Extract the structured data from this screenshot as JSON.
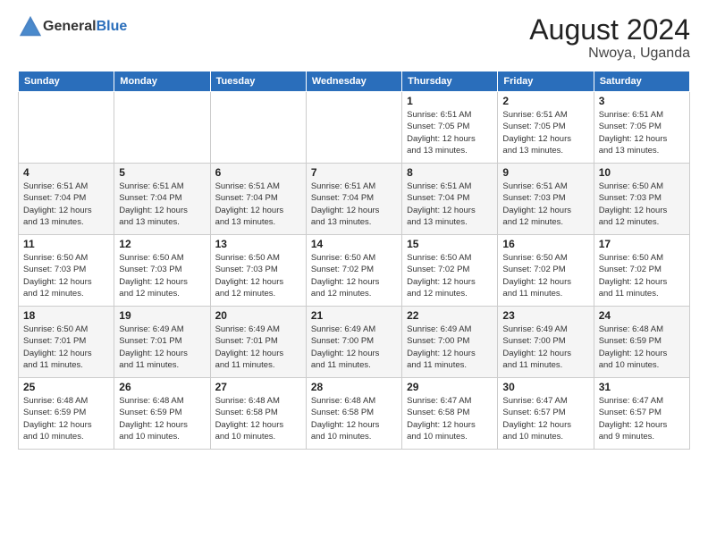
{
  "header": {
    "logo_general": "General",
    "logo_blue": "Blue",
    "main_title": "August 2024",
    "sub_title": "Nwoya, Uganda"
  },
  "days_of_week": [
    "Sunday",
    "Monday",
    "Tuesday",
    "Wednesday",
    "Thursday",
    "Friday",
    "Saturday"
  ],
  "weeks": [
    [
      {
        "num": "",
        "detail": ""
      },
      {
        "num": "",
        "detail": ""
      },
      {
        "num": "",
        "detail": ""
      },
      {
        "num": "",
        "detail": ""
      },
      {
        "num": "1",
        "detail": "Sunrise: 6:51 AM\nSunset: 7:05 PM\nDaylight: 12 hours\nand 13 minutes."
      },
      {
        "num": "2",
        "detail": "Sunrise: 6:51 AM\nSunset: 7:05 PM\nDaylight: 12 hours\nand 13 minutes."
      },
      {
        "num": "3",
        "detail": "Sunrise: 6:51 AM\nSunset: 7:05 PM\nDaylight: 12 hours\nand 13 minutes."
      }
    ],
    [
      {
        "num": "4",
        "detail": "Sunrise: 6:51 AM\nSunset: 7:04 PM\nDaylight: 12 hours\nand 13 minutes."
      },
      {
        "num": "5",
        "detail": "Sunrise: 6:51 AM\nSunset: 7:04 PM\nDaylight: 12 hours\nand 13 minutes."
      },
      {
        "num": "6",
        "detail": "Sunrise: 6:51 AM\nSunset: 7:04 PM\nDaylight: 12 hours\nand 13 minutes."
      },
      {
        "num": "7",
        "detail": "Sunrise: 6:51 AM\nSunset: 7:04 PM\nDaylight: 12 hours\nand 13 minutes."
      },
      {
        "num": "8",
        "detail": "Sunrise: 6:51 AM\nSunset: 7:04 PM\nDaylight: 12 hours\nand 13 minutes."
      },
      {
        "num": "9",
        "detail": "Sunrise: 6:51 AM\nSunset: 7:03 PM\nDaylight: 12 hours\nand 12 minutes."
      },
      {
        "num": "10",
        "detail": "Sunrise: 6:50 AM\nSunset: 7:03 PM\nDaylight: 12 hours\nand 12 minutes."
      }
    ],
    [
      {
        "num": "11",
        "detail": "Sunrise: 6:50 AM\nSunset: 7:03 PM\nDaylight: 12 hours\nand 12 minutes."
      },
      {
        "num": "12",
        "detail": "Sunrise: 6:50 AM\nSunset: 7:03 PM\nDaylight: 12 hours\nand 12 minutes."
      },
      {
        "num": "13",
        "detail": "Sunrise: 6:50 AM\nSunset: 7:03 PM\nDaylight: 12 hours\nand 12 minutes."
      },
      {
        "num": "14",
        "detail": "Sunrise: 6:50 AM\nSunset: 7:02 PM\nDaylight: 12 hours\nand 12 minutes."
      },
      {
        "num": "15",
        "detail": "Sunrise: 6:50 AM\nSunset: 7:02 PM\nDaylight: 12 hours\nand 12 minutes."
      },
      {
        "num": "16",
        "detail": "Sunrise: 6:50 AM\nSunset: 7:02 PM\nDaylight: 12 hours\nand 11 minutes."
      },
      {
        "num": "17",
        "detail": "Sunrise: 6:50 AM\nSunset: 7:02 PM\nDaylight: 12 hours\nand 11 minutes."
      }
    ],
    [
      {
        "num": "18",
        "detail": "Sunrise: 6:50 AM\nSunset: 7:01 PM\nDaylight: 12 hours\nand 11 minutes."
      },
      {
        "num": "19",
        "detail": "Sunrise: 6:49 AM\nSunset: 7:01 PM\nDaylight: 12 hours\nand 11 minutes."
      },
      {
        "num": "20",
        "detail": "Sunrise: 6:49 AM\nSunset: 7:01 PM\nDaylight: 12 hours\nand 11 minutes."
      },
      {
        "num": "21",
        "detail": "Sunrise: 6:49 AM\nSunset: 7:00 PM\nDaylight: 12 hours\nand 11 minutes."
      },
      {
        "num": "22",
        "detail": "Sunrise: 6:49 AM\nSunset: 7:00 PM\nDaylight: 12 hours\nand 11 minutes."
      },
      {
        "num": "23",
        "detail": "Sunrise: 6:49 AM\nSunset: 7:00 PM\nDaylight: 12 hours\nand 11 minutes."
      },
      {
        "num": "24",
        "detail": "Sunrise: 6:48 AM\nSunset: 6:59 PM\nDaylight: 12 hours\nand 10 minutes."
      }
    ],
    [
      {
        "num": "25",
        "detail": "Sunrise: 6:48 AM\nSunset: 6:59 PM\nDaylight: 12 hours\nand 10 minutes."
      },
      {
        "num": "26",
        "detail": "Sunrise: 6:48 AM\nSunset: 6:59 PM\nDaylight: 12 hours\nand 10 minutes."
      },
      {
        "num": "27",
        "detail": "Sunrise: 6:48 AM\nSunset: 6:58 PM\nDaylight: 12 hours\nand 10 minutes."
      },
      {
        "num": "28",
        "detail": "Sunrise: 6:48 AM\nSunset: 6:58 PM\nDaylight: 12 hours\nand 10 minutes."
      },
      {
        "num": "29",
        "detail": "Sunrise: 6:47 AM\nSunset: 6:58 PM\nDaylight: 12 hours\nand 10 minutes."
      },
      {
        "num": "30",
        "detail": "Sunrise: 6:47 AM\nSunset: 6:57 PM\nDaylight: 12 hours\nand 10 minutes."
      },
      {
        "num": "31",
        "detail": "Sunrise: 6:47 AM\nSunset: 6:57 PM\nDaylight: 12 hours\nand 9 minutes."
      }
    ]
  ]
}
